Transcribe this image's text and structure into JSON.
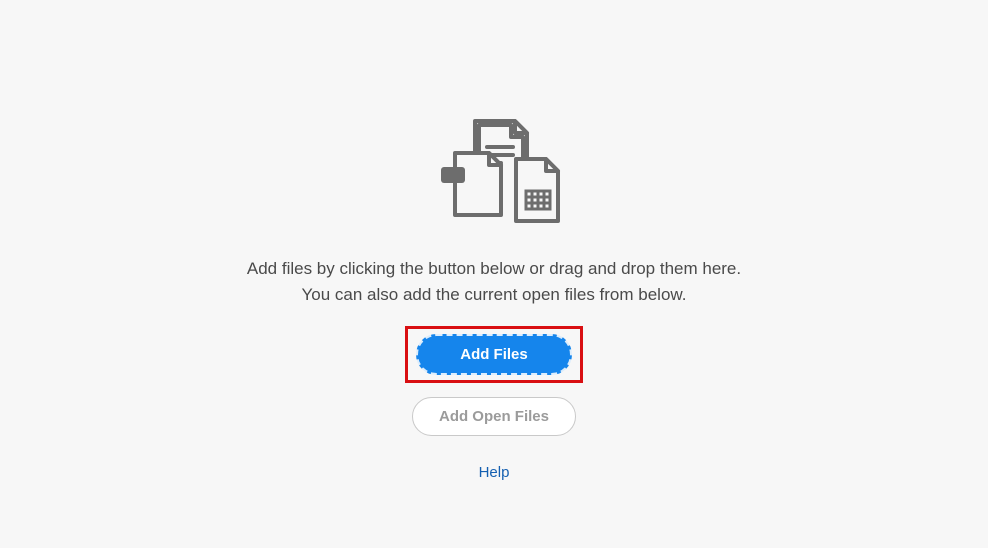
{
  "instructions": {
    "line1": "Add files by clicking the button below or drag and drop them here.",
    "line2": "You can also add the current open files from below."
  },
  "buttons": {
    "add_files": "Add Files",
    "add_open_files": "Add Open Files"
  },
  "help_label": "Help"
}
